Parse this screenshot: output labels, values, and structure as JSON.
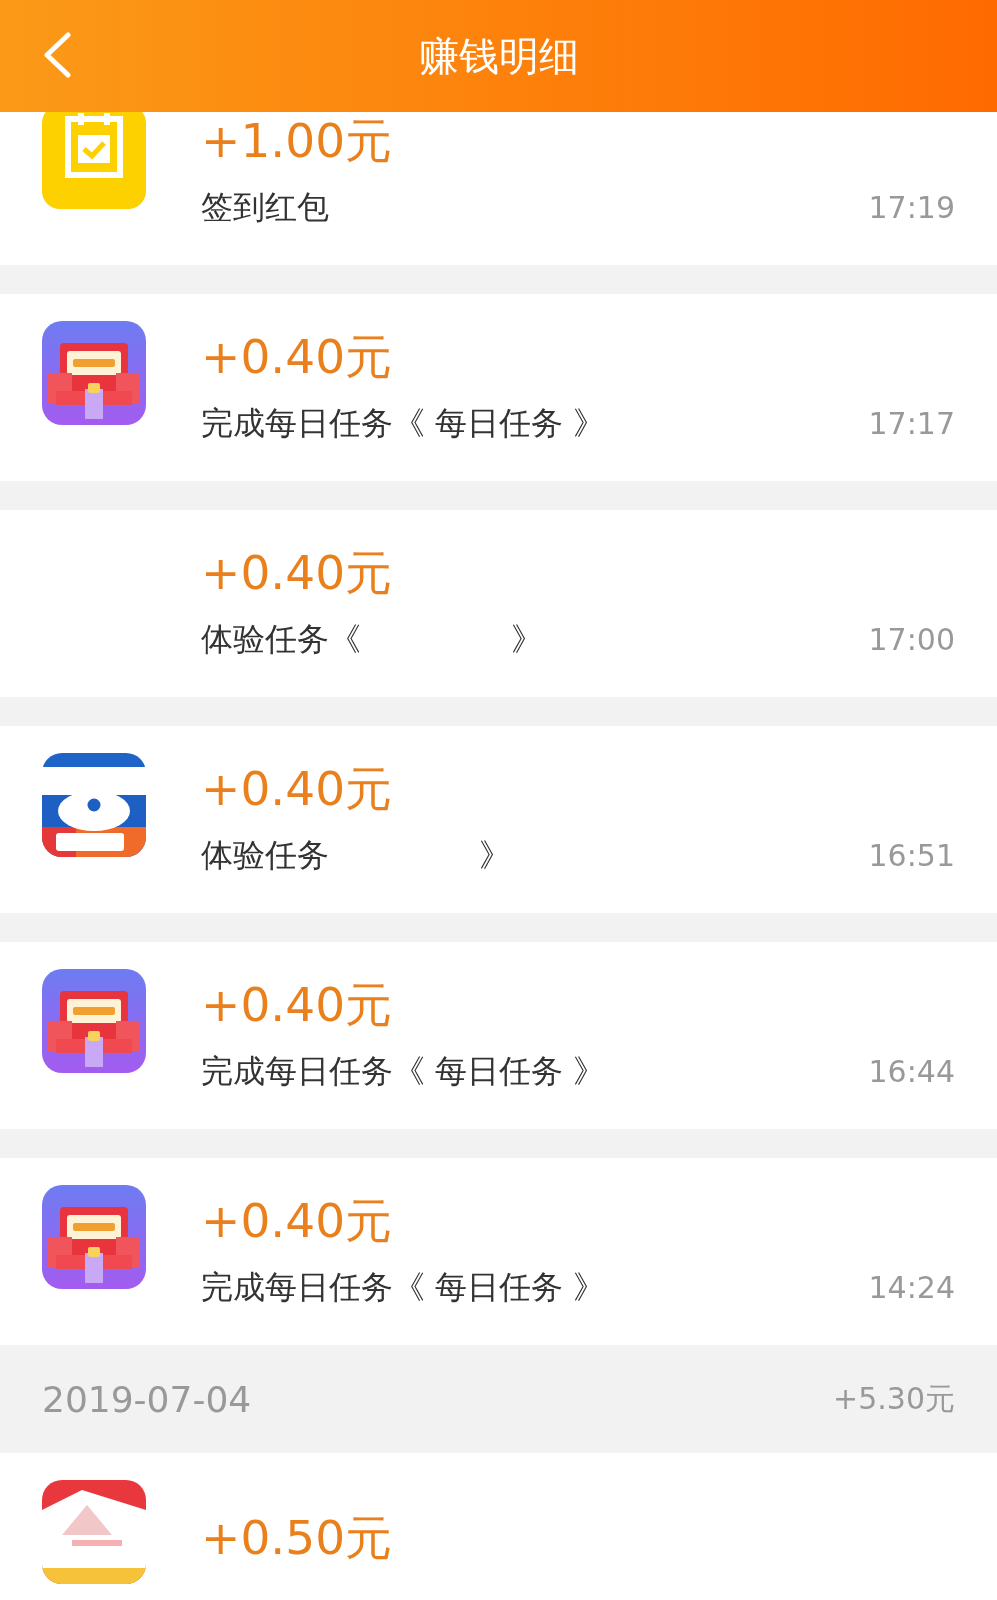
{
  "header": {
    "title": "赚钱明细"
  },
  "sections": [
    {
      "items": [
        {
          "kind": "calendar",
          "amount": "+1.00元",
          "desc": "签到红包",
          "time": "17:19"
        },
        {
          "kind": "task",
          "amount": "+0.40元",
          "desc": "完成每日任务《 每日任务 》",
          "time": "17:17"
        },
        {
          "kind": "blank",
          "amount": "+0.40元",
          "desc": "体验任务《",
          "desc_end": "》",
          "time": "17:00"
        },
        {
          "kind": "car",
          "amount": "+0.40元",
          "desc": "体验任务",
          "desc_end": "》",
          "time": "16:51"
        },
        {
          "kind": "task",
          "amount": "+0.40元",
          "desc": "完成每日任务《 每日任务 》",
          "time": "16:44"
        },
        {
          "kind": "task",
          "amount": "+0.40元",
          "desc": "完成每日任务《 每日任务 》",
          "time": "14:24"
        }
      ]
    },
    {
      "date": "2019-07-04",
      "total": "+5.30元",
      "items": [
        {
          "kind": "photo",
          "amount": "+0.50元"
        }
      ]
    }
  ]
}
